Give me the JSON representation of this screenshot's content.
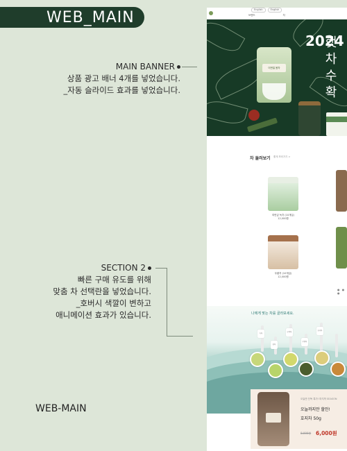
{
  "header": {
    "title": "WEB_MAIN"
  },
  "annotations": {
    "banner": {
      "heading": "MAIN BANNER",
      "line1": "상품 광고 배너 4개를 넣었습니다.",
      "line2": "_자동 슬라이드 효과를 넣었습니다."
    },
    "section2": {
      "heading": "SECTION 2",
      "line1": "빠른 구매 유도를 위해",
      "line2": "맞춤 차 선택란을 넣었습니다.",
      "line3": "_호버시 색깔이 변하고",
      "line4": "애니메이션 효과가 있습니다."
    }
  },
  "footer_label": "WEB-MAIN",
  "mockup": {
    "nav": {
      "lang": [
        "English",
        "English"
      ],
      "menu": [
        "브랜드",
        "차"
      ]
    },
    "banner": {
      "year": "2024",
      "headline": "햇차수확",
      "pack_label": "이번일 봄차"
    },
    "products_section": {
      "title": "차 둘러보기",
      "subtitle": "좋게 보러가기 >",
      "items": [
        {
          "name": "여린잎 녹차 (10개입)",
          "price": "12,000원"
        },
        {
          "name": "우롱차 (10개입)",
          "price": "12,000원"
        }
      ]
    },
    "finder": {
      "title": "나에게 맞는 차를 골라보세요.",
      "tags": [
        "녹차",
        "홍차",
        "보이차",
        "우롱차",
        "호지차"
      ]
    },
    "sale": {
      "small": "오늘만 단독 특가! 마지막 SEASON",
      "line1": "오늘까지만 할인!",
      "line2": "호지차 50g",
      "old_price": "8,000원",
      "price": "6,000원"
    }
  },
  "colors": {
    "page_bg": "#dde6d8",
    "pill_bg": "#1f3d2b",
    "banner_bg": "#173a26",
    "accent_teal": "#2e7a74",
    "sale_red": "#c0392b"
  }
}
